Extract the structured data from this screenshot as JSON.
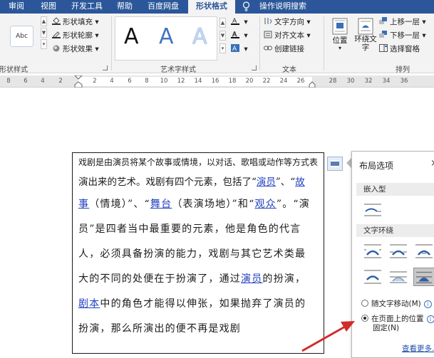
{
  "tabs": [
    {
      "label": "审阅",
      "active": false
    },
    {
      "label": "视图",
      "active": false
    },
    {
      "label": "开发工具",
      "active": false
    },
    {
      "label": "帮助",
      "active": false
    },
    {
      "label": "百度网盘",
      "active": false
    },
    {
      "label": "形状格式",
      "active": true
    },
    {
      "label": "操作说明搜索",
      "active": false
    }
  ],
  "ribbon": {
    "shape_styles": {
      "group_label": "形状样式",
      "preview_text": "Abc",
      "fill": "形状填充",
      "outline": "形状轮廓",
      "effects": "形状效果"
    },
    "wordart": {
      "group_label": "艺术字样式",
      "sample": "A"
    },
    "text": {
      "group_label": "文本",
      "direction": "文字方向",
      "align": "对齐文本",
      "link": "创建链接"
    },
    "arrange": {
      "group_label": "排列",
      "position": "位置",
      "wrap_line1": "环绕文",
      "wrap_line2": "字",
      "bring_forward": "上移一层",
      "send_backward": "下移一层",
      "selection_pane": "选择窗格"
    }
  },
  "ruler": {
    "labels": [
      "8",
      "6",
      "4",
      "2",
      "2",
      "4",
      "6",
      "8",
      "10",
      "12",
      "14",
      "16",
      "18",
      "20",
      "22",
      "24",
      "26",
      "28",
      "30",
      "32",
      "34",
      "36"
    ]
  },
  "document": {
    "line1": "戏剧是由演员将某个故事或情境，以对话、歌唱或动作等方式表",
    "line2_a": "演出来的艺术。戏剧有四个元素，包括了“",
    "line2_link1": "演员",
    "line2_b": "”、“",
    "line2_link2": "故",
    "line3_link": "事",
    "line3_a": "（情境）”、“",
    "line3_link2": "舞台",
    "line3_b": "（表演场地）”和“",
    "line3_link3": "观众",
    "line3_c": "”。“演",
    "line4": "员”是四者当中最重要的元素，他是角色的代言",
    "line5": "人，必须具备扮演的能力，戏剧与其它艺术类最",
    "line6_a": "大的不同的处便在于扮演了，通过",
    "line6_link": "演员",
    "line6_b": "的扮演，",
    "line7_link": "剧本",
    "line7_a": "中的角色才能得以伸张，如果抛弃了演员的",
    "line8": "扮演，那么所演出的便不再是戏剧"
  },
  "layout_panel": {
    "title": "布局选项",
    "close": "×",
    "inline_section": "嵌入型",
    "wrap_section": "文字环绕",
    "move_with_text": "随文字移动(M)",
    "fix_position_line1": "在页面上的位置",
    "fix_position_line2": "固定(N)",
    "info": "i",
    "see_more": "查看更多..."
  },
  "colors": {
    "title_bar": "#2b579a",
    "ribbon_bg": "#f3f3f3",
    "link": "#1f3fbf",
    "arrow": "#d22a2a"
  }
}
